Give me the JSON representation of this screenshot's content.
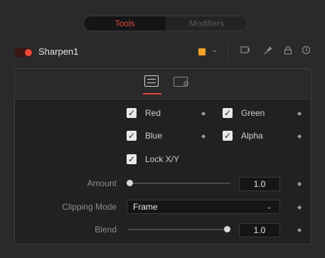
{
  "tabs": {
    "tools": "Tools",
    "modifiers": "Modifiers"
  },
  "node": {
    "name": "Sharpen1",
    "color": "#f2a328",
    "enabled": true
  },
  "header_icons": [
    "chevron-down-icon",
    "viewer-icon",
    "pin-icon",
    "lock-icon",
    "reset-icon"
  ],
  "panel_tabs": [
    "controls-icon",
    "settings-icon"
  ],
  "channels": {
    "red": {
      "label": "Red",
      "checked": true
    },
    "green": {
      "label": "Green",
      "checked": true
    },
    "blue": {
      "label": "Blue",
      "checked": true
    },
    "alpha": {
      "label": "Alpha",
      "checked": true
    },
    "lock": {
      "label": "Lock X/Y",
      "checked": true
    }
  },
  "amount": {
    "label": "Amount",
    "value": "1.0",
    "slider_fraction": 0.0
  },
  "clipping": {
    "label": "Clipping Mode",
    "value": "Frame"
  },
  "blend": {
    "label": "Blend",
    "value": "1.0",
    "slider_fraction": 1.0
  },
  "accent": "#e0483b"
}
